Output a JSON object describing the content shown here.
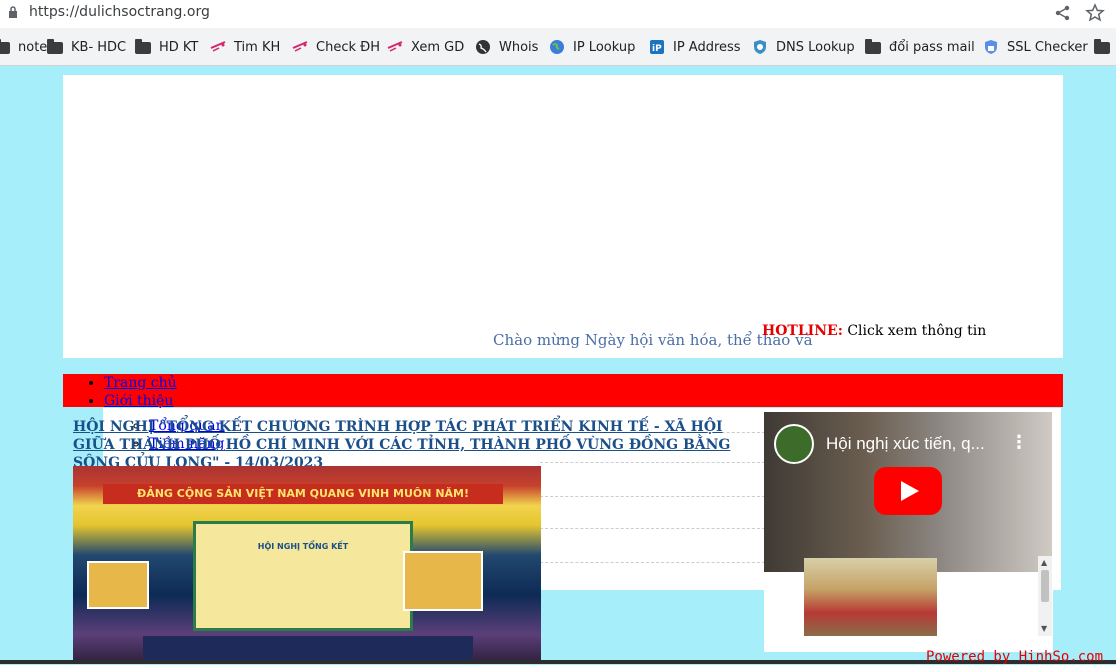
{
  "browser": {
    "url": "https://dulichsoctrang.org",
    "bookmarks": [
      {
        "label": "notes",
        "icon": "folder-icon"
      },
      {
        "label": "KB- HDC",
        "icon": "folder-icon"
      },
      {
        "label": "HD KT",
        "icon": "folder-icon"
      },
      {
        "label": "Tim KH",
        "icon": "bookmark-logo-icon"
      },
      {
        "label": "Check ĐH",
        "icon": "bookmark-logo-icon"
      },
      {
        "label": "Xem GD",
        "icon": "bookmark-logo-icon"
      },
      {
        "label": "Whois",
        "icon": "globe-icon"
      },
      {
        "label": "IP Lookup",
        "icon": "earth-icon"
      },
      {
        "label": "IP Address",
        "icon": "ip-icon"
      },
      {
        "label": "DNS Lookup",
        "icon": "dns-shield-icon"
      },
      {
        "label": "đổi pass mail",
        "icon": "folder-icon"
      },
      {
        "label": "SSL Checker",
        "icon": "ssl-shield-icon"
      }
    ]
  },
  "banner": {
    "marquee_text": "Chào mừng Ngày hội văn hóa, thể thao và",
    "hotline_label": "HOTLINE:",
    "hotline_text": " Click xem thông tin"
  },
  "menu": {
    "items": [
      "Trang chủ",
      "Giới thiệu"
    ],
    "sub_items": [
      "Tổng quan",
      "Tiềm năng"
    ]
  },
  "article": {
    "headline_link": "HỘI NGHỊ \"TỔNG KẾT CHƯƠNG TRÌNH HỢP TÁC PHÁT TRIỂN KINH TẾ - XÃ HỘI GIỮA THÀNH PHỐ HỒ CHÍ MINH VỚI CÁC TỈNH, THÀNH PHỐ VÙNG ĐỒNG BẰNG SÔNG CỬU LONG\"",
    "headline_date": " - 14/03/2023",
    "photo_sign": "ĐẢNG CỘNG SẢN VIỆT NAM QUANG VINH MUÔN NĂM!",
    "photo_stage_title": "HỘI NGHỊ TỔNG KẾT"
  },
  "video": {
    "title": "Hội nghị xúc tiến, q..."
  },
  "footer": {
    "powered": "Powered by HinhSo.com"
  },
  "colors": {
    "page_bg": "#a5eefa",
    "nav_red": "#ff0000",
    "link_blue": "#0000ee",
    "headline_blue": "#1a4f8a",
    "hotline_red": "#e60000"
  }
}
